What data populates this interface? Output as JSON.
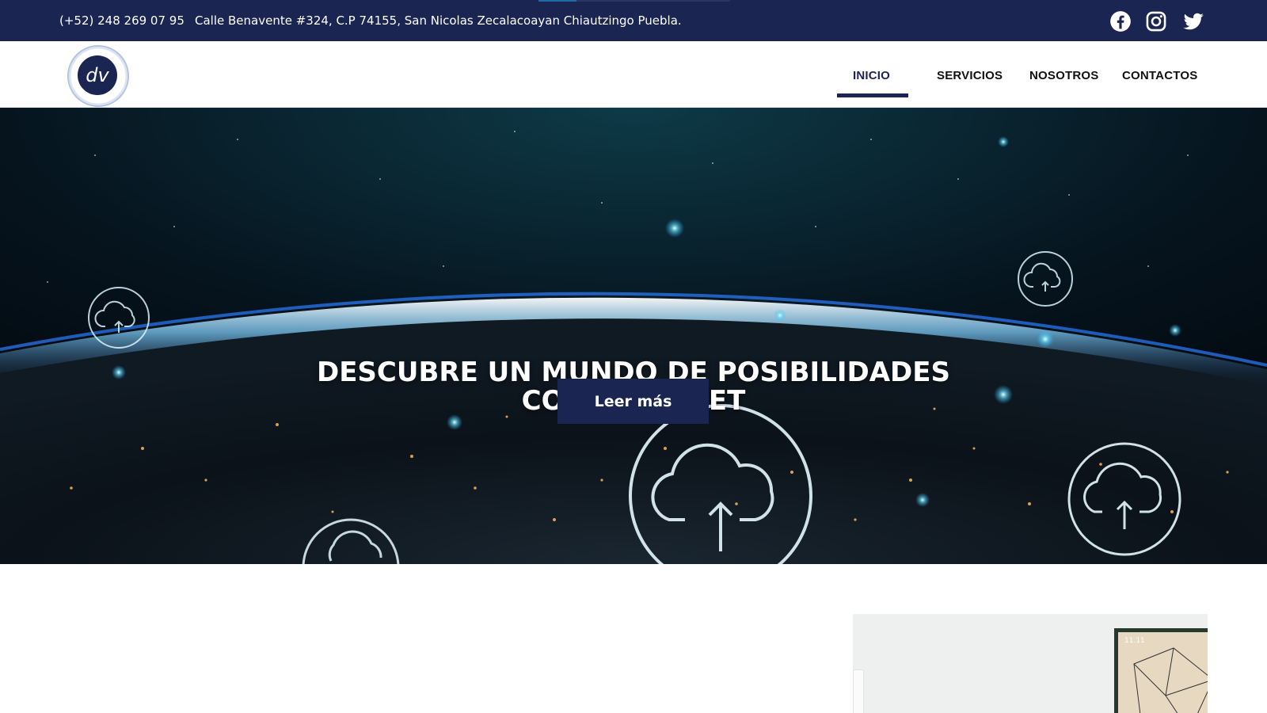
{
  "topbar": {
    "phone": "(+52) 248 269 07 95",
    "address": "Calle Benavente #324, C.P 74155, San Nicolas Zecalacoayan Chiautzingo Puebla.",
    "background": "#1b2552",
    "social": [
      {
        "name": "facebook-icon"
      },
      {
        "name": "instagram-icon"
      },
      {
        "name": "twitter-icon"
      }
    ]
  },
  "logo": {
    "text": "dv",
    "color": "#1b2552"
  },
  "nav": {
    "items": [
      {
        "label": "INICIO",
        "active": true
      },
      {
        "label": "SERVICIOS",
        "active": false
      },
      {
        "label": "NOSOTROS",
        "active": false
      },
      {
        "label": "CONTACTOS",
        "active": false
      }
    ],
    "active_color": "#1b2552"
  },
  "hero": {
    "title_line1": "DESCUBRE UN MUNDO DE POSIBILIDADES",
    "title_line2": "CON INTERNET",
    "button_label": "Leer más",
    "button_color": "#1b2552",
    "icons": [
      "cloud-upload-icon"
    ]
  },
  "photo": {
    "frame_text": "11.11"
  }
}
